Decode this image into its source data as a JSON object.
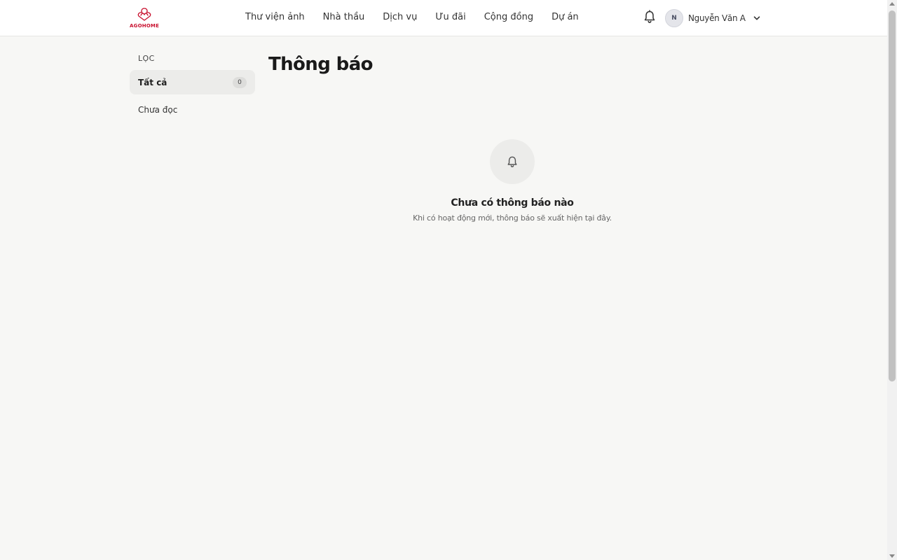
{
  "brand": {
    "logo_text": "AGOHOME",
    "logo_icon": "agohome-logo-icon",
    "accent": "#c8102e"
  },
  "nav": {
    "items": [
      {
        "label": "Thư viện ảnh"
      },
      {
        "label": "Nhà thầu"
      },
      {
        "label": "Dịch vụ"
      },
      {
        "label": "Ưu đãi"
      },
      {
        "label": "Cộng đồng"
      },
      {
        "label": "Dự án"
      }
    ]
  },
  "header": {
    "bell_icon": "bell-icon",
    "user": {
      "initial": "N",
      "name": "Nguyễn Văn A",
      "menu_icon": "chevron-down-icon"
    }
  },
  "sidebar": {
    "title": "LỌC",
    "filters": [
      {
        "label": "Tất cả",
        "count": "0",
        "active": true
      },
      {
        "label": "Chưa đọc",
        "active": false
      }
    ]
  },
  "main": {
    "title": "Thông báo",
    "empty_state": {
      "icon": "bell-icon",
      "title": "Chưa có thông báo nào",
      "subtitle": "Khi có hoạt động mới, thông báo sẽ xuất hiện tại đây."
    }
  },
  "colors": {
    "background": "#f7f7f5",
    "header_bg": "#ffffff",
    "active_filter_bg": "#ececea"
  }
}
